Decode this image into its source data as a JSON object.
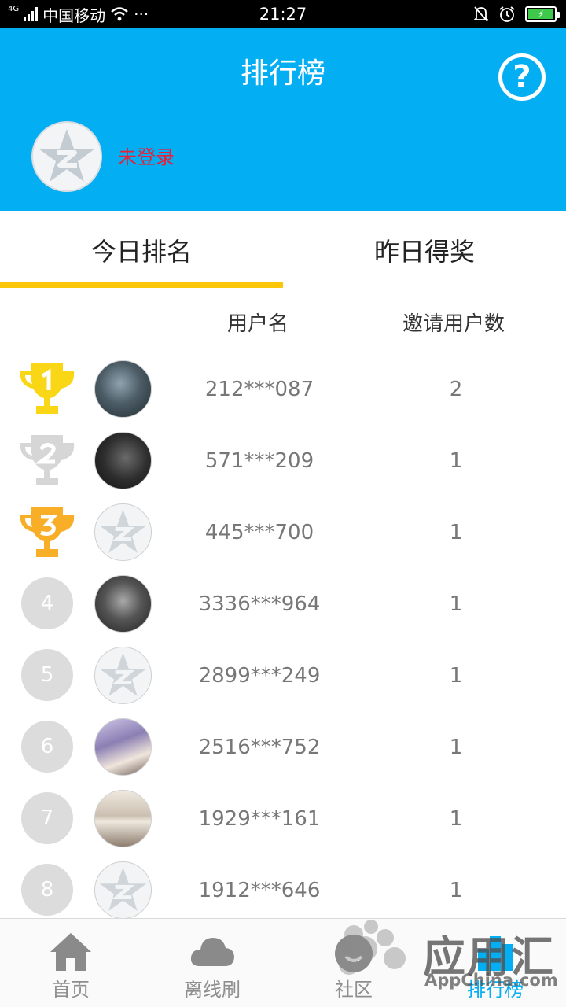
{
  "status_bar": {
    "network": "4G",
    "carrier": "中国移动",
    "dots": "···",
    "time": "21:27",
    "battery_color": "#3ec94a"
  },
  "header": {
    "title": "排行榜",
    "help_label": "?",
    "login_status": "未登录",
    "background": "#03aef2"
  },
  "tabs": [
    {
      "label": "今日排名",
      "active": true
    },
    {
      "label": "昨日得奖",
      "active": false
    }
  ],
  "columns": {
    "username": "用户名",
    "invites": "邀请用户数"
  },
  "ranking": [
    {
      "rank": "1",
      "badge": "gold-trophy-icon",
      "avatar": "photo-avatar",
      "username": "212***087",
      "invites": "2"
    },
    {
      "rank": "2",
      "badge": "silver-trophy-icon",
      "avatar": "photo-avatar",
      "username": "571***209",
      "invites": "1"
    },
    {
      "rank": "3",
      "badge": "bronze-trophy-icon",
      "avatar": "default-avatar",
      "username": "445***700",
      "invites": "1"
    },
    {
      "rank": "4",
      "badge": "rank-circle",
      "avatar": "photo-avatar",
      "username": "3336***964",
      "invites": "1"
    },
    {
      "rank": "5",
      "badge": "rank-circle",
      "avatar": "default-avatar",
      "username": "2899***249",
      "invites": "1"
    },
    {
      "rank": "6",
      "badge": "rank-circle",
      "avatar": "photo-avatar",
      "username": "2516***752",
      "invites": "1"
    },
    {
      "rank": "7",
      "badge": "rank-circle",
      "avatar": "photo-avatar",
      "username": "1929***161",
      "invites": "1"
    },
    {
      "rank": "8",
      "badge": "rank-circle",
      "avatar": "default-avatar",
      "username": "1912***646",
      "invites": "1"
    }
  ],
  "bottom_nav": [
    {
      "label": "首页",
      "icon": "home-icon",
      "active": false
    },
    {
      "label": "离线刷",
      "icon": "cloud-icon",
      "active": false
    },
    {
      "label": "社区",
      "icon": "community-icon",
      "active": false
    },
    {
      "label": "排行榜",
      "icon": "ranking-icon",
      "active": true
    }
  ],
  "watermark": {
    "title": "应用汇",
    "subtitle": "AppChina.com"
  },
  "colors": {
    "accent": "#03aef2",
    "tab_underline": "#fcc70b",
    "gold": "#f9d717",
    "silver": "#d6d6d6",
    "bronze": "#f8ae26",
    "login_red": "#e8203a"
  }
}
